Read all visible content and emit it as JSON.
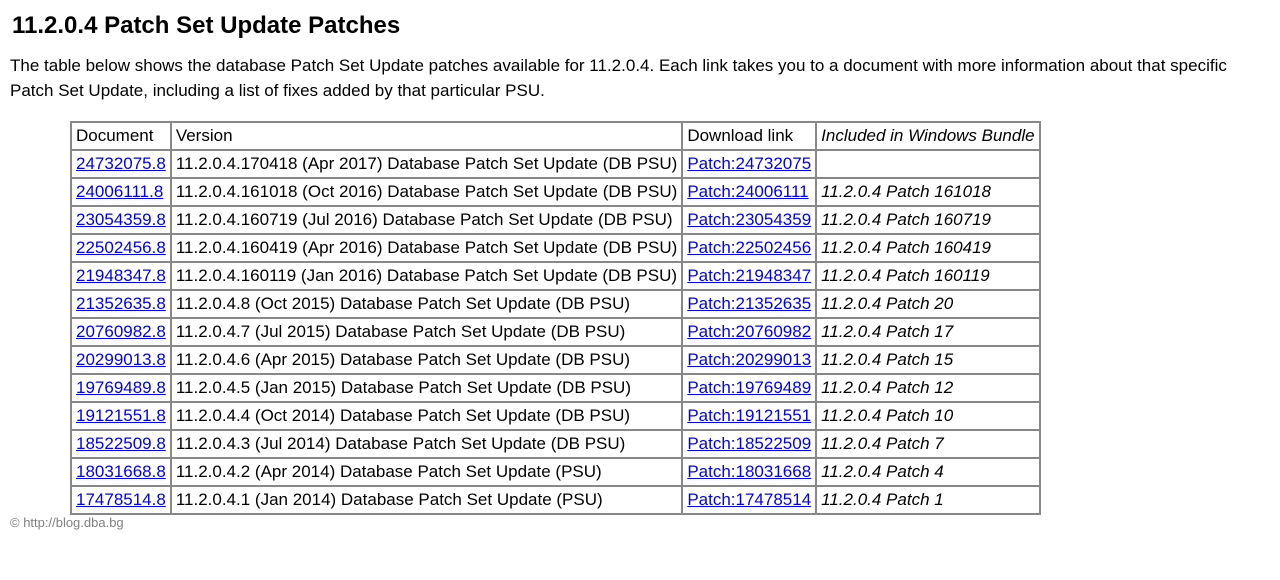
{
  "heading": "11.2.0.4 Patch Set Update Patches",
  "intro": "The table below shows the database Patch Set Update patches available for 11.2.0.4. Each link takes you to a document with more information about that specific Patch Set Update, including a list of fixes added by that particular PSU.",
  "columns": {
    "doc": "Document",
    "ver": "Version",
    "dl": "Download link",
    "win": "Included in Windows Bundle"
  },
  "rows": [
    {
      "doc": "24732075.8",
      "ver": "11.2.0.4.170418 (Apr 2017) Database Patch Set Update (DB PSU)",
      "dl": "Patch:24732075",
      "win": ""
    },
    {
      "doc": "24006111.8",
      "ver": "11.2.0.4.161018 (Oct 2016) Database Patch Set Update (DB PSU)",
      "dl": "Patch:24006111",
      "win": "11.2.0.4 Patch 161018"
    },
    {
      "doc": "23054359.8",
      "ver": "11.2.0.4.160719 (Jul 2016) Database Patch Set Update (DB PSU)",
      "dl": "Patch:23054359",
      "win": "11.2.0.4 Patch 160719"
    },
    {
      "doc": "22502456.8",
      "ver": "11.2.0.4.160419 (Apr 2016) Database Patch Set Update (DB PSU)",
      "dl": "Patch:22502456",
      "win": "11.2.0.4 Patch 160419"
    },
    {
      "doc": "21948347.8",
      "ver": "11.2.0.4.160119 (Jan 2016) Database Patch Set Update (DB PSU)",
      "dl": "Patch:21948347",
      "win": "11.2.0.4 Patch 160119"
    },
    {
      "doc": "21352635.8",
      "ver": "11.2.0.4.8 (Oct 2015) Database Patch Set Update (DB PSU)",
      "dl": "Patch:21352635",
      "win": "11.2.0.4 Patch 20"
    },
    {
      "doc": "20760982.8",
      "ver": "11.2.0.4.7 (Jul 2015) Database Patch Set Update (DB PSU)",
      "dl": "Patch:20760982",
      "win": "11.2.0.4 Patch 17"
    },
    {
      "doc": "20299013.8",
      "ver": "11.2.0.4.6 (Apr 2015) Database Patch Set Update (DB PSU)",
      "dl": "Patch:20299013",
      "win": "11.2.0.4 Patch 15"
    },
    {
      "doc": "19769489.8",
      "ver": "11.2.0.4.5 (Jan 2015) Database Patch Set Update (DB PSU)",
      "dl": "Patch:19769489",
      "win": "11.2.0.4 Patch 12"
    },
    {
      "doc": "19121551.8",
      "ver": "11.2.0.4.4 (Oct 2014) Database Patch Set Update (DB PSU)",
      "dl": "Patch:19121551",
      "win": "11.2.0.4 Patch 10"
    },
    {
      "doc": "18522509.8",
      "ver": "11.2.0.4.3 (Jul 2014) Database Patch Set Update (DB PSU)",
      "dl": "Patch:18522509",
      "win": "11.2.0.4 Patch 7"
    },
    {
      "doc": "18031668.8",
      "ver": "11.2.0.4.2 (Apr 2014) Database Patch Set Update (PSU)",
      "dl": "Patch:18031668",
      "win": "11.2.0.4 Patch 4"
    },
    {
      "doc": "17478514.8",
      "ver": "11.2.0.4.1 (Jan 2014) Database Patch Set Update (PSU)",
      "dl": "Patch:17478514",
      "win": "11.2.0.4 Patch 1"
    }
  ],
  "footer": "© http://blog.dba.bg"
}
